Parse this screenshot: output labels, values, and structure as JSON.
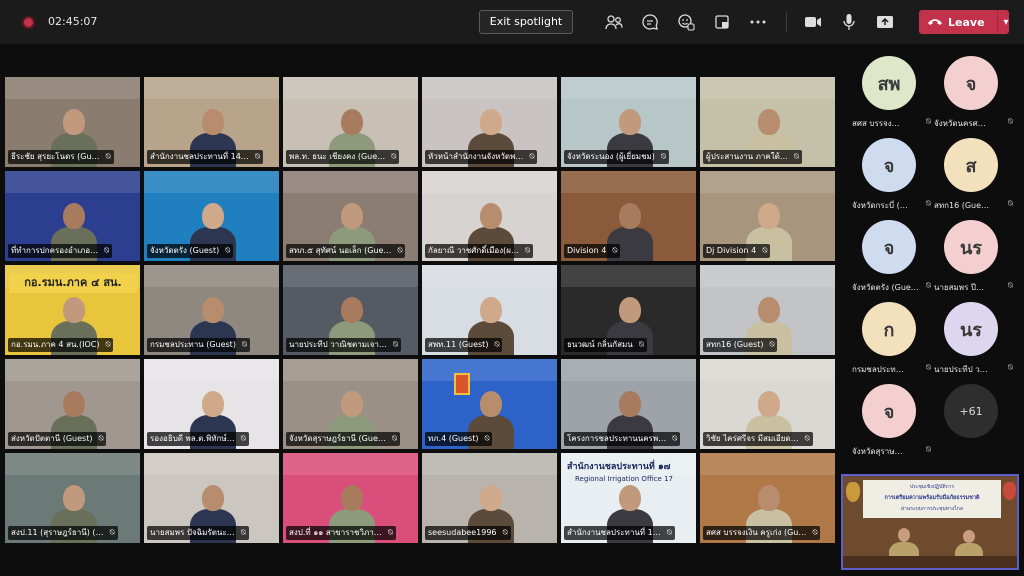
{
  "topbar": {
    "timer": "02:45:07",
    "exit_spotlight": "Exit spotlight",
    "leave_label": "Leave",
    "icons": [
      "people-icon",
      "chat-icon",
      "reactions-icon",
      "share-tray-icon",
      "more-icon",
      "camera-icon",
      "mic-icon",
      "share-icon"
    ]
  },
  "tiles": [
    {
      "name": "ธีระชัย สุรยะโนดร (Gu…",
      "bg": "#8a7d70"
    },
    {
      "name": "สำนักงานชลประทานที่ 14…",
      "bg": "#b8a48a"
    },
    {
      "name": "พล.ท. ธนะ เชียงคง (Gue…",
      "bg": "#c8c0b5"
    },
    {
      "name": "หัวหน้าสำนักงานจังหวัดพ…",
      "bg": "#c9c4c2"
    },
    {
      "name": "จังหวัดระนอง (ผู้เยี่ยมชม)",
      "bg": "#b7c7c8"
    },
    {
      "name": "ผู้ประสานงาน ภาคใต้…",
      "bg": "#c5c0a8"
    },
    {
      "name": "ที่ทำการปกครองอำเภอ…",
      "bg": "#2b3e8f"
    },
    {
      "name": "จังหวัดตรัง (Guest)",
      "bg": "#1f7fbf"
    },
    {
      "name": "สทภ.๕ สุทัศน์ นอเล็ก (Gue…",
      "bg": "#8c7d73"
    },
    {
      "name": "กัลยาณี วาชศักดิ์เมือง(ผ…",
      "bg": "#d7d3d0"
    },
    {
      "name": "Division 4",
      "bg": "#8a5a3a"
    },
    {
      "name": "Dj Division 4",
      "bg": "#a8957e"
    },
    {
      "name": "กอ.รมน.ภาค 4 สน.(IOC)",
      "bg": "#e8c53a"
    },
    {
      "name": "กรมชลประทาน (Guest)",
      "bg": "#8f8880"
    },
    {
      "name": "นายประทีป วาณิชตามเจา…",
      "bg": "#555a63"
    },
    {
      "name": "สพท.11 (Guest)",
      "bg": "#d8dce3"
    },
    {
      "name": "ธนวฒน์ กลิ่นกัสมน",
      "bg": "#2a2a2a"
    },
    {
      "name": "สทก16 (Guest)",
      "bg": "#c2c4c8"
    },
    {
      "name": "ส่งหวัดปัตตานี (Guest)",
      "bg": "#a09890"
    },
    {
      "name": "รองอธิบดี พล.ต.พิทักษ์…",
      "bg": "#e6e4e6"
    },
    {
      "name": "จังหวัดสุราษฎร์ธานี (Gue…",
      "bg": "#9a9085"
    },
    {
      "name": "ทภ.4 (Guest)",
      "bg": "#2d63c9"
    },
    {
      "name": "โครงการชลประทานนครพ…",
      "bg": "#9da3a8"
    },
    {
      "name": "วิชัย ไคร่ศรีจร มีสมเอียด…",
      "bg": "#dad8d2"
    },
    {
      "name": "สงป.11 (สุราษฎร์ธานี) (…",
      "bg": "#6b7a76"
    },
    {
      "name": "นายสมพร ปัจฉิมรัตนะ…",
      "bg": "#ccc6c0"
    },
    {
      "name": "สงป.ที่ ๑๑ สาขาราชวิภา…",
      "bg": "#d94e7a"
    },
    {
      "name": "seesudabee1996",
      "bg": "#b8b4ad"
    },
    {
      "name": "สำนักงานชลประทานที่ 1…",
      "bg": "#e9eef2"
    },
    {
      "name": "สศส บรรจงเงิน ครูเก่ง (Gu…",
      "bg": "#b07846"
    }
  ],
  "tile_top_texts": {
    "office17_th": "สำนักงานชลประทานที่ ๑๗",
    "office17_en": "Regional Irrigation Office 17",
    "ioc_big": "กอ.รมน.ภาค ๔ สน."
  },
  "roster": [
    {
      "initials": "สพ",
      "name": "สศส บรรจง…",
      "color": "#dfe6c9"
    },
    {
      "initials": "จ",
      "name": "จังหวัดนครศ…",
      "color": "#f3cfd0"
    },
    {
      "initials": "จ",
      "name": "จังหวัดกระบี่ (…",
      "color": "#cfdbee"
    },
    {
      "initials": "ส",
      "name": "สทก16 (Gue…",
      "color": "#f3e0bd"
    },
    {
      "initials": "จ",
      "name": "จังหวัดตรัง (Gue…",
      "color": "#cfdbee"
    },
    {
      "initials": "นร",
      "name": "นายสมพร ปี…",
      "color": "#f3cfd0"
    },
    {
      "initials": "ก",
      "name": "กรมชลประท…",
      "color": "#f3e0bd"
    },
    {
      "initials": "นร",
      "name": "นายประทีป ว…",
      "color": "#dcd6ef"
    },
    {
      "initials": "จ",
      "name": "จังหวัดสุราษ…",
      "color": "#f3cfd0"
    }
  ],
  "more_count": "+61",
  "selfview": {
    "banner_line1": "ประชุมเชิงปฏิบัติการ",
    "banner_line2": "การเตรียมความพร้อมรับมือภัยธรรมชาติ",
    "banner_line3": "ผ่านระบบการประชุมทางไกล"
  }
}
